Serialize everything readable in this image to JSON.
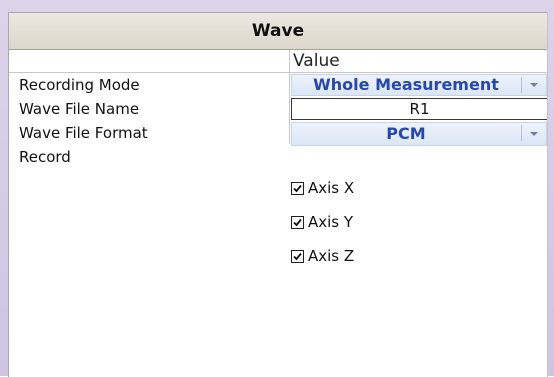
{
  "window": {
    "title": "Wave"
  },
  "grid": {
    "value_header": "Value"
  },
  "rows": {
    "recording_mode": {
      "label": "Recording Mode",
      "value": "Whole Measurement"
    },
    "wave_file_name": {
      "label": "Wave File Name",
      "value": "R1"
    },
    "wave_file_format": {
      "label": "Wave File Format",
      "value": "PCM"
    },
    "record": {
      "label": "Record",
      "options": [
        {
          "label": "Axis X",
          "checked": true
        },
        {
          "label": "Axis Y",
          "checked": true
        },
        {
          "label": "Axis Z",
          "checked": true
        }
      ]
    }
  },
  "colors": {
    "combo_text": "#2848a8",
    "frame": "#d6cce6"
  }
}
